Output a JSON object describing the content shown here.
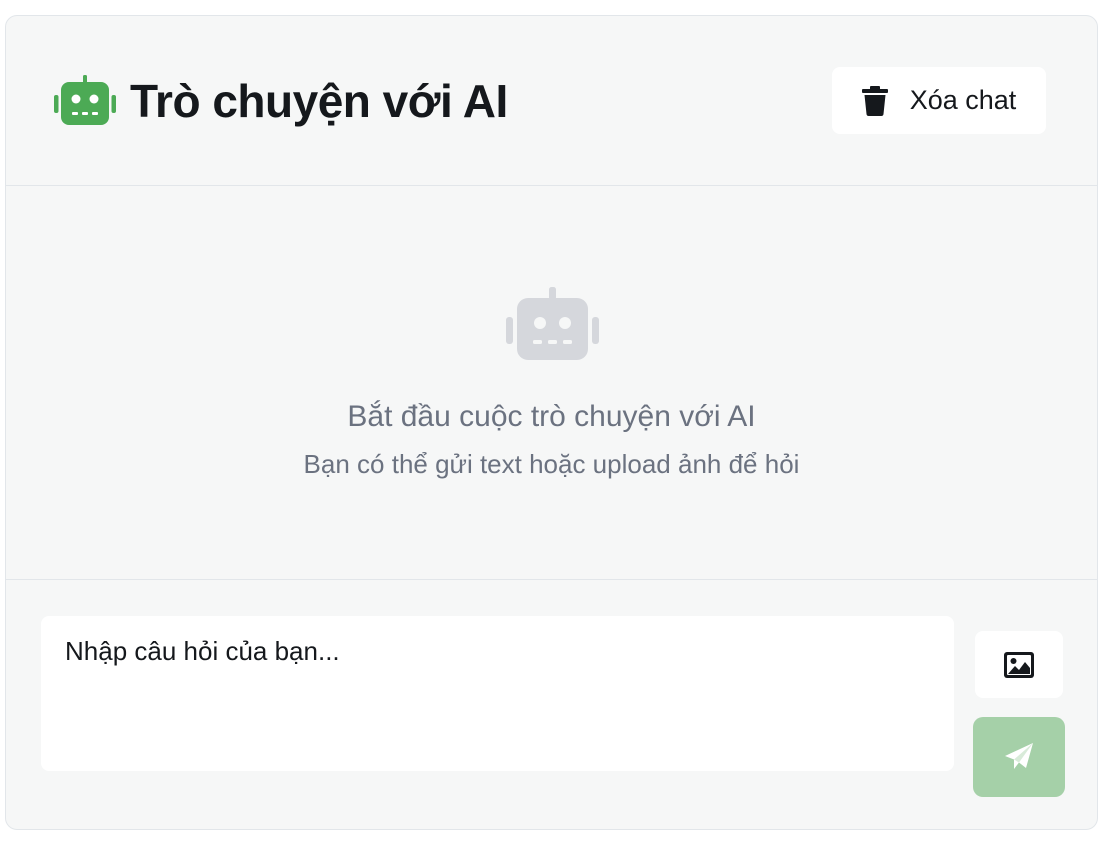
{
  "header": {
    "title": "Trò chuyện với AI",
    "icon": "robot-icon",
    "icon_color": "#4caa55",
    "clear_button": {
      "label": "Xóa chat",
      "icon": "trash-icon"
    }
  },
  "empty_state": {
    "icon": "robot-icon",
    "icon_color": "#d5d7dc",
    "title": "Bắt đầu cuộc trò chuyện với AI",
    "subtitle": "Bạn có thể gửi text hoặc upload ảnh để hỏi"
  },
  "composer": {
    "input_value": "",
    "input_placeholder": "Nhập câu hỏi của bạn...",
    "image_button_icon": "image-icon",
    "send_button_icon": "paper-plane-icon",
    "send_button_color": "#a5d0a8"
  }
}
